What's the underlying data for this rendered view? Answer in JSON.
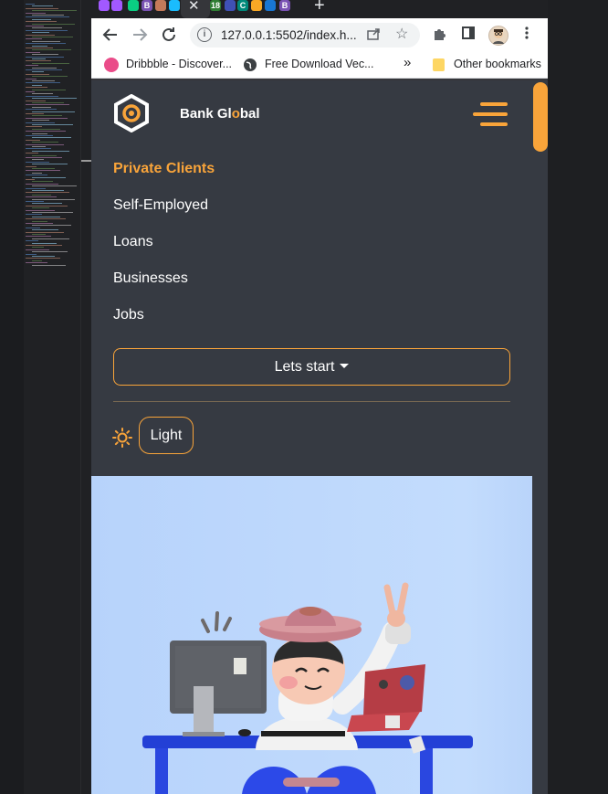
{
  "browser": {
    "tab_close_glyph": "✕",
    "new_tab_glyph": "+",
    "favicons": [
      {
        "icon": "figma-icon",
        "color": "#a259ff",
        "text": ""
      },
      {
        "icon": "figma-icon",
        "color": "#a259ff",
        "text": ""
      },
      {
        "icon": "figma-icon",
        "color": "#0acf83",
        "text": ""
      },
      {
        "icon": "bootstrap-icon",
        "color": "#7952b3",
        "text": "B"
      },
      {
        "icon": "avatar-icon",
        "color": "#c47a5a",
        "text": ""
      },
      {
        "icon": "figma-icon",
        "color": "#1abcfe",
        "text": ""
      },
      {
        "icon": "number-icon",
        "color": "#2e7d32",
        "text": "18"
      },
      {
        "icon": "tab-icon",
        "color": "#3f51b5",
        "text": ""
      },
      {
        "icon": "c-icon",
        "color": "#00897b",
        "text": "C"
      },
      {
        "icon": "tab-icon",
        "color": "#f9a825",
        "text": ""
      },
      {
        "icon": "tab-icon",
        "color": "#1976d2",
        "text": ""
      },
      {
        "icon": "bootstrap-icon",
        "color": "#7952b3",
        "text": "B"
      }
    ],
    "url": "127.0.0.1:5502/index.h...",
    "bookmarks": [
      {
        "label": "Dribbble - Discover...",
        "icon": "dribbble-icon",
        "color": "#ea4c89"
      },
      {
        "label": "Free Download Vec...",
        "icon": "globe-icon",
        "color": "#3c4043"
      }
    ],
    "overflow_glyph": "»",
    "other_bookmarks": "Other bookmarks"
  },
  "site": {
    "brand_prefix": "Bank Gl",
    "brand_highlight": "o",
    "brand_suffix": "bal",
    "nav": [
      {
        "label": "Private Clients",
        "active": true
      },
      {
        "label": "Self-Employed",
        "active": false
      },
      {
        "label": "Loans",
        "active": false
      },
      {
        "label": "Businesses",
        "active": false
      },
      {
        "label": "Jobs",
        "active": false
      }
    ],
    "start_button": "Lets start",
    "theme_button": "Light"
  },
  "colors": {
    "accent": "#f9a43a",
    "page_bg": "#363a42",
    "hero_bg": "#c3dcfd"
  }
}
